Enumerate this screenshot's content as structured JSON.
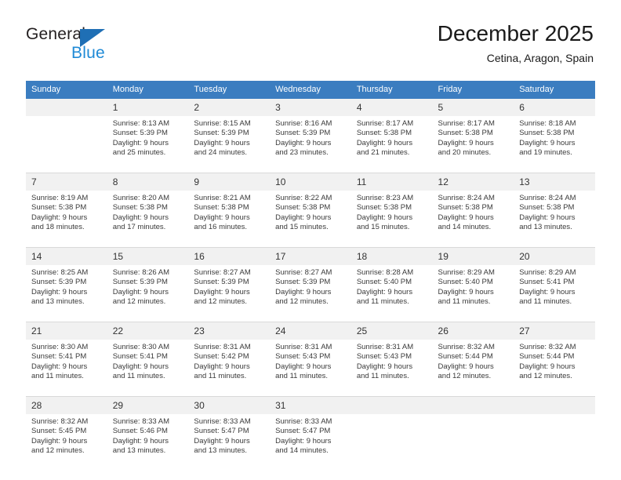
{
  "brand": {
    "name_primary": "General",
    "name_secondary": "Blue",
    "triangle_color": "#1f6fb5",
    "secondary_color": "#1f8ad6"
  },
  "header": {
    "title": "December 2025",
    "subtitle": "Cetina, Aragon, Spain"
  },
  "theme": {
    "header_bg": "#3b7dc0",
    "header_text": "#ffffff",
    "date_band_bg": "#f1f1f1",
    "row_divider": "#2b6cab"
  },
  "calendar": {
    "weekdays": [
      "Sunday",
      "Monday",
      "Tuesday",
      "Wednesday",
      "Thursday",
      "Friday",
      "Saturday"
    ],
    "weeks": [
      [
        {
          "day": "",
          "sunrise": "",
          "sunset": "",
          "daylight_line1": "",
          "daylight_line2": ""
        },
        {
          "day": "1",
          "sunrise": "Sunrise: 8:13 AM",
          "sunset": "Sunset: 5:39 PM",
          "daylight_line1": "Daylight: 9 hours",
          "daylight_line2": "and 25 minutes."
        },
        {
          "day": "2",
          "sunrise": "Sunrise: 8:15 AM",
          "sunset": "Sunset: 5:39 PM",
          "daylight_line1": "Daylight: 9 hours",
          "daylight_line2": "and 24 minutes."
        },
        {
          "day": "3",
          "sunrise": "Sunrise: 8:16 AM",
          "sunset": "Sunset: 5:39 PM",
          "daylight_line1": "Daylight: 9 hours",
          "daylight_line2": "and 23 minutes."
        },
        {
          "day": "4",
          "sunrise": "Sunrise: 8:17 AM",
          "sunset": "Sunset: 5:38 PM",
          "daylight_line1": "Daylight: 9 hours",
          "daylight_line2": "and 21 minutes."
        },
        {
          "day": "5",
          "sunrise": "Sunrise: 8:17 AM",
          "sunset": "Sunset: 5:38 PM",
          "daylight_line1": "Daylight: 9 hours",
          "daylight_line2": "and 20 minutes."
        },
        {
          "day": "6",
          "sunrise": "Sunrise: 8:18 AM",
          "sunset": "Sunset: 5:38 PM",
          "daylight_line1": "Daylight: 9 hours",
          "daylight_line2": "and 19 minutes."
        }
      ],
      [
        {
          "day": "7",
          "sunrise": "Sunrise: 8:19 AM",
          "sunset": "Sunset: 5:38 PM",
          "daylight_line1": "Daylight: 9 hours",
          "daylight_line2": "and 18 minutes."
        },
        {
          "day": "8",
          "sunrise": "Sunrise: 8:20 AM",
          "sunset": "Sunset: 5:38 PM",
          "daylight_line1": "Daylight: 9 hours",
          "daylight_line2": "and 17 minutes."
        },
        {
          "day": "9",
          "sunrise": "Sunrise: 8:21 AM",
          "sunset": "Sunset: 5:38 PM",
          "daylight_line1": "Daylight: 9 hours",
          "daylight_line2": "and 16 minutes."
        },
        {
          "day": "10",
          "sunrise": "Sunrise: 8:22 AM",
          "sunset": "Sunset: 5:38 PM",
          "daylight_line1": "Daylight: 9 hours",
          "daylight_line2": "and 15 minutes."
        },
        {
          "day": "11",
          "sunrise": "Sunrise: 8:23 AM",
          "sunset": "Sunset: 5:38 PM",
          "daylight_line1": "Daylight: 9 hours",
          "daylight_line2": "and 15 minutes."
        },
        {
          "day": "12",
          "sunrise": "Sunrise: 8:24 AM",
          "sunset": "Sunset: 5:38 PM",
          "daylight_line1": "Daylight: 9 hours",
          "daylight_line2": "and 14 minutes."
        },
        {
          "day": "13",
          "sunrise": "Sunrise: 8:24 AM",
          "sunset": "Sunset: 5:38 PM",
          "daylight_line1": "Daylight: 9 hours",
          "daylight_line2": "and 13 minutes."
        }
      ],
      [
        {
          "day": "14",
          "sunrise": "Sunrise: 8:25 AM",
          "sunset": "Sunset: 5:39 PM",
          "daylight_line1": "Daylight: 9 hours",
          "daylight_line2": "and 13 minutes."
        },
        {
          "day": "15",
          "sunrise": "Sunrise: 8:26 AM",
          "sunset": "Sunset: 5:39 PM",
          "daylight_line1": "Daylight: 9 hours",
          "daylight_line2": "and 12 minutes."
        },
        {
          "day": "16",
          "sunrise": "Sunrise: 8:27 AM",
          "sunset": "Sunset: 5:39 PM",
          "daylight_line1": "Daylight: 9 hours",
          "daylight_line2": "and 12 minutes."
        },
        {
          "day": "17",
          "sunrise": "Sunrise: 8:27 AM",
          "sunset": "Sunset: 5:39 PM",
          "daylight_line1": "Daylight: 9 hours",
          "daylight_line2": "and 12 minutes."
        },
        {
          "day": "18",
          "sunrise": "Sunrise: 8:28 AM",
          "sunset": "Sunset: 5:40 PM",
          "daylight_line1": "Daylight: 9 hours",
          "daylight_line2": "and 11 minutes."
        },
        {
          "day": "19",
          "sunrise": "Sunrise: 8:29 AM",
          "sunset": "Sunset: 5:40 PM",
          "daylight_line1": "Daylight: 9 hours",
          "daylight_line2": "and 11 minutes."
        },
        {
          "day": "20",
          "sunrise": "Sunrise: 8:29 AM",
          "sunset": "Sunset: 5:41 PM",
          "daylight_line1": "Daylight: 9 hours",
          "daylight_line2": "and 11 minutes."
        }
      ],
      [
        {
          "day": "21",
          "sunrise": "Sunrise: 8:30 AM",
          "sunset": "Sunset: 5:41 PM",
          "daylight_line1": "Daylight: 9 hours",
          "daylight_line2": "and 11 minutes."
        },
        {
          "day": "22",
          "sunrise": "Sunrise: 8:30 AM",
          "sunset": "Sunset: 5:41 PM",
          "daylight_line1": "Daylight: 9 hours",
          "daylight_line2": "and 11 minutes."
        },
        {
          "day": "23",
          "sunrise": "Sunrise: 8:31 AM",
          "sunset": "Sunset: 5:42 PM",
          "daylight_line1": "Daylight: 9 hours",
          "daylight_line2": "and 11 minutes."
        },
        {
          "day": "24",
          "sunrise": "Sunrise: 8:31 AM",
          "sunset": "Sunset: 5:43 PM",
          "daylight_line1": "Daylight: 9 hours",
          "daylight_line2": "and 11 minutes."
        },
        {
          "day": "25",
          "sunrise": "Sunrise: 8:31 AM",
          "sunset": "Sunset: 5:43 PM",
          "daylight_line1": "Daylight: 9 hours",
          "daylight_line2": "and 11 minutes."
        },
        {
          "day": "26",
          "sunrise": "Sunrise: 8:32 AM",
          "sunset": "Sunset: 5:44 PM",
          "daylight_line1": "Daylight: 9 hours",
          "daylight_line2": "and 12 minutes."
        },
        {
          "day": "27",
          "sunrise": "Sunrise: 8:32 AM",
          "sunset": "Sunset: 5:44 PM",
          "daylight_line1": "Daylight: 9 hours",
          "daylight_line2": "and 12 minutes."
        }
      ],
      [
        {
          "day": "28",
          "sunrise": "Sunrise: 8:32 AM",
          "sunset": "Sunset: 5:45 PM",
          "daylight_line1": "Daylight: 9 hours",
          "daylight_line2": "and 12 minutes."
        },
        {
          "day": "29",
          "sunrise": "Sunrise: 8:33 AM",
          "sunset": "Sunset: 5:46 PM",
          "daylight_line1": "Daylight: 9 hours",
          "daylight_line2": "and 13 minutes."
        },
        {
          "day": "30",
          "sunrise": "Sunrise: 8:33 AM",
          "sunset": "Sunset: 5:47 PM",
          "daylight_line1": "Daylight: 9 hours",
          "daylight_line2": "and 13 minutes."
        },
        {
          "day": "31",
          "sunrise": "Sunrise: 8:33 AM",
          "sunset": "Sunset: 5:47 PM",
          "daylight_line1": "Daylight: 9 hours",
          "daylight_line2": "and 14 minutes."
        },
        {
          "day": "",
          "sunrise": "",
          "sunset": "",
          "daylight_line1": "",
          "daylight_line2": ""
        },
        {
          "day": "",
          "sunrise": "",
          "sunset": "",
          "daylight_line1": "",
          "daylight_line2": ""
        },
        {
          "day": "",
          "sunrise": "",
          "sunset": "",
          "daylight_line1": "",
          "daylight_line2": ""
        }
      ]
    ]
  }
}
